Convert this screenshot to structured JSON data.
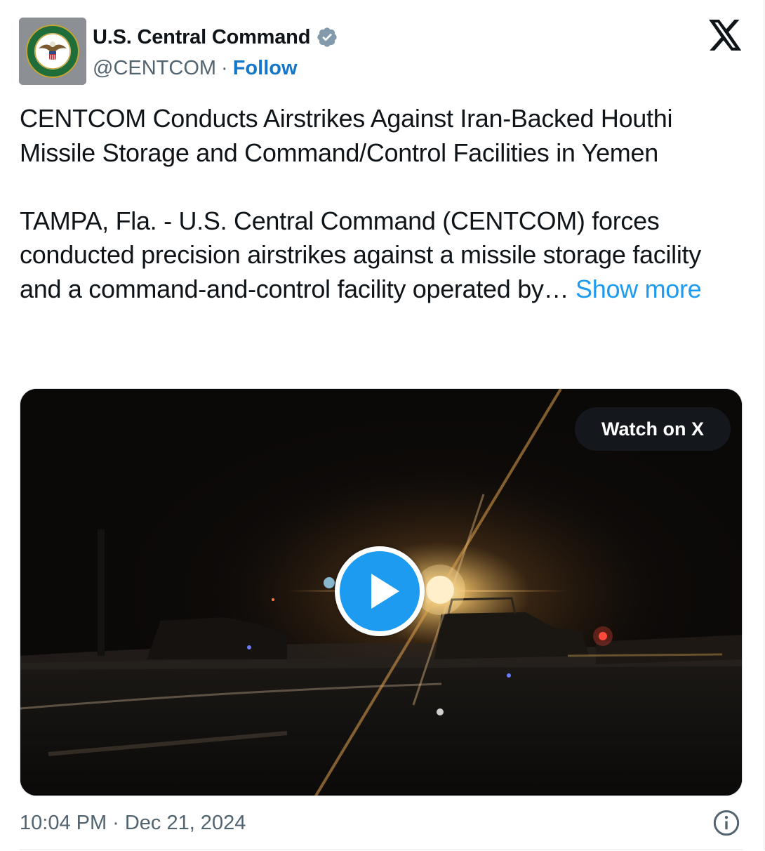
{
  "author": {
    "display_name": "U.S. Central Command",
    "handle": "@CENTCOM",
    "separator": "·",
    "follow_label": "Follow",
    "verified": true,
    "avatar_icon": "centcom-seal-icon"
  },
  "brand": {
    "logo_icon": "x-logo-icon"
  },
  "tweet": {
    "headline": "CENTCOM Conducts Airstrikes Against Iran-Backed Houthi Missile Storage and Command/Control Facilities in Yemen",
    "body": "TAMPA, Fla. - U.S. Central Command (CENTCOM) forces conducted precision airstrikes against a missile storage facility and a command-and-control facility operated by…",
    "show_more_label": "Show more"
  },
  "media": {
    "type": "video",
    "watch_label": "Watch on X",
    "play_icon": "play-icon"
  },
  "footer": {
    "time": "10:04 PM",
    "separator": "·",
    "date": "Dec 21, 2024",
    "info_icon": "info-icon"
  },
  "colors": {
    "text": "#0f1419",
    "muted": "#536471",
    "link": "#1d9bf0",
    "follow": "#1476c9",
    "verified_badge": "#829aab"
  }
}
